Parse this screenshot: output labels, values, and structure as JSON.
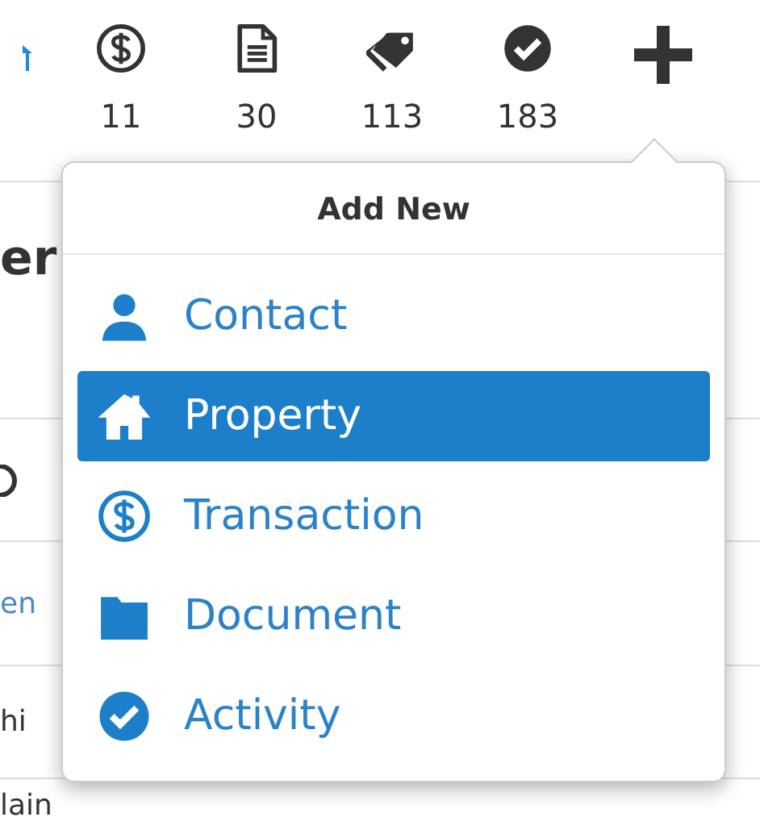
{
  "toolbar": {
    "items": [
      {
        "kind": "dollar",
        "count": "11"
      },
      {
        "kind": "document",
        "count": "30"
      },
      {
        "kind": "tag",
        "count": "113"
      },
      {
        "kind": "check",
        "count": "183"
      },
      {
        "kind": "plus"
      }
    ]
  },
  "background_rows": [
    {
      "kind": "heading",
      "text": "er"
    },
    {
      "kind": "icon"
    },
    {
      "kind": "link",
      "text": "en"
    },
    {
      "kind": "plain",
      "text": "hi"
    },
    {
      "kind": "plain",
      "text": "lain"
    }
  ],
  "menu": {
    "title": "Add New",
    "items": [
      {
        "kind": "person",
        "label": "Contact",
        "selected": false
      },
      {
        "kind": "house",
        "label": "Property",
        "selected": true
      },
      {
        "kind": "dollar",
        "label": "Transaction",
        "selected": false
      },
      {
        "kind": "folder",
        "label": "Document",
        "selected": false
      },
      {
        "kind": "check",
        "label": "Activity",
        "selected": false
      }
    ]
  }
}
